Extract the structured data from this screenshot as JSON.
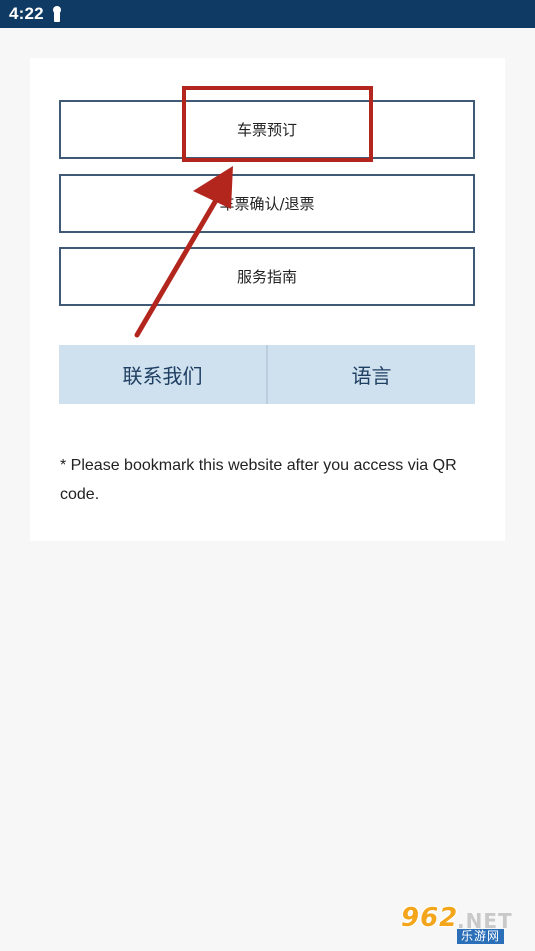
{
  "status_bar": {
    "time": "4:22",
    "icon": "person-icon"
  },
  "menu": {
    "items": [
      {
        "label": "车票预订"
      },
      {
        "label": "车票确认/退票"
      },
      {
        "label": "服务指南"
      }
    ]
  },
  "bottom_actions": {
    "contact_label": "联系我们",
    "language_label": "语言"
  },
  "note": "* Please bookmark this website after you access via QR code.",
  "annotation": {
    "highlight_color": "#b3261e"
  },
  "watermark": {
    "brand": "962",
    "domain": ".NET",
    "subtitle": "乐游网"
  },
  "colors": {
    "status_bar": "#0e3a63",
    "button_border": "#3f5a74",
    "bottom_button_bg": "#cfe1ef",
    "bottom_button_text": "#1f3f62"
  }
}
